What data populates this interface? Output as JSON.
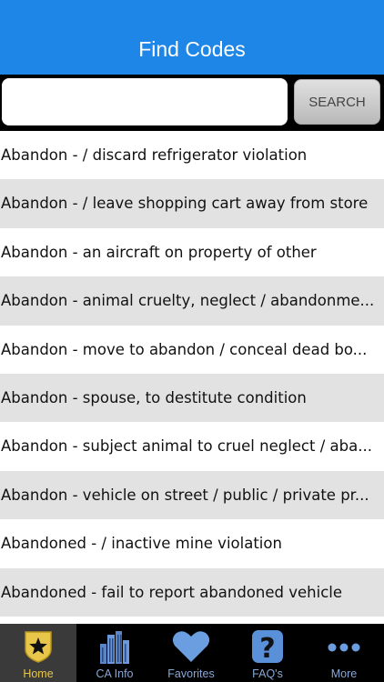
{
  "header": {
    "title": "Find Codes"
  },
  "search": {
    "placeholder": "",
    "button_label": "SEARCH"
  },
  "list": {
    "items": [
      "Abandon - / discard refrigerator violation",
      "Abandon - / leave shopping cart away from store",
      "Abandon - an aircraft on property of other",
      "Abandon - animal cruelty, neglect / abandonme...",
      "Abandon - move to abandon / conceal dead bo...",
      "Abandon - spouse, to destitute condition",
      "Abandon - subject animal to cruel neglect / aba...",
      "Abandon - vehicle on street / public / private pr...",
      "Abandoned - / inactive mine violation",
      "Abandoned - fail to report abandoned vehicle"
    ]
  },
  "tabs": [
    {
      "label": "Home",
      "icon": "star-badge-icon",
      "active": true
    },
    {
      "label": "CA Info",
      "icon": "buildings-icon"
    },
    {
      "label": "Favorites",
      "icon": "heart-icon"
    },
    {
      "label": "FAQ's",
      "icon": "question-icon"
    },
    {
      "label": "More",
      "icon": "more-dots-icon"
    }
  ],
  "colors": {
    "header": "#1e86e6",
    "row_alt": "#e2e2e2",
    "tab_active_label": "#e8c64a",
    "tab_label": "#8aa6d6"
  }
}
